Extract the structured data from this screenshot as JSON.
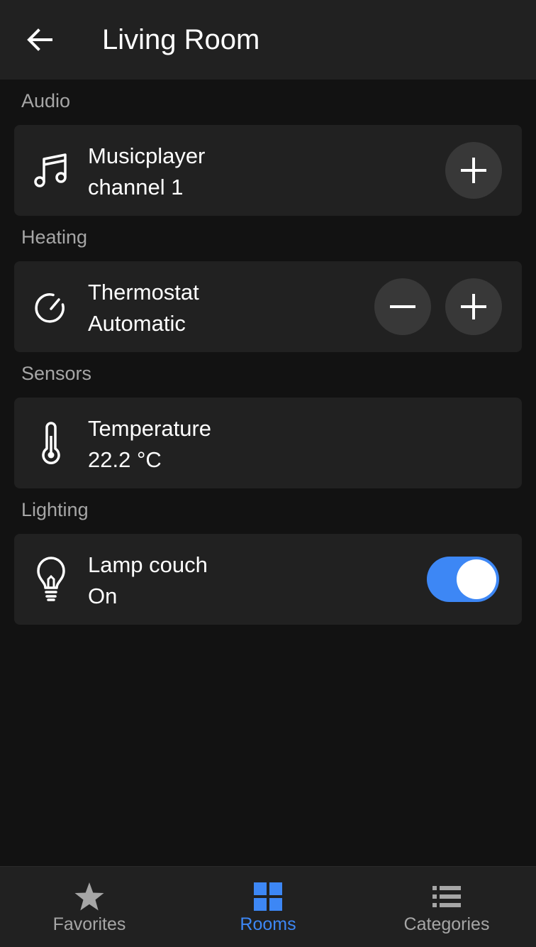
{
  "header": {
    "title": "Living Room",
    "back_icon": "arrow-left-icon"
  },
  "sections": [
    {
      "label": "Audio",
      "device": {
        "name": "Musicplayer",
        "state": "channel 1",
        "icon": "music-note-icon",
        "controls": [
          "plus-icon"
        ]
      }
    },
    {
      "label": "Heating",
      "device": {
        "name": "Thermostat",
        "state": "Automatic",
        "icon": "gauge-icon",
        "controls": [
          "minus-icon",
          "plus-icon"
        ]
      }
    },
    {
      "label": "Sensors",
      "device": {
        "name": "Temperature",
        "state": "22.2 °C",
        "icon": "thermometer-icon",
        "controls": []
      }
    },
    {
      "label": "Lighting",
      "device": {
        "name": "Lamp couch",
        "state": "On",
        "icon": "lightbulb-icon",
        "toggle_on": true
      }
    }
  ],
  "bottom_nav": {
    "items": [
      {
        "label": "Favorites",
        "icon": "star-icon",
        "active": false
      },
      {
        "label": "Rooms",
        "icon": "grid-icon",
        "active": true
      },
      {
        "label": "Categories",
        "icon": "list-icon",
        "active": false
      }
    ]
  },
  "colors": {
    "background": "#121212",
    "surface": "#212121",
    "button": "#383838",
    "accent": "#3d87f5",
    "muted_text": "#a6a6a6"
  }
}
